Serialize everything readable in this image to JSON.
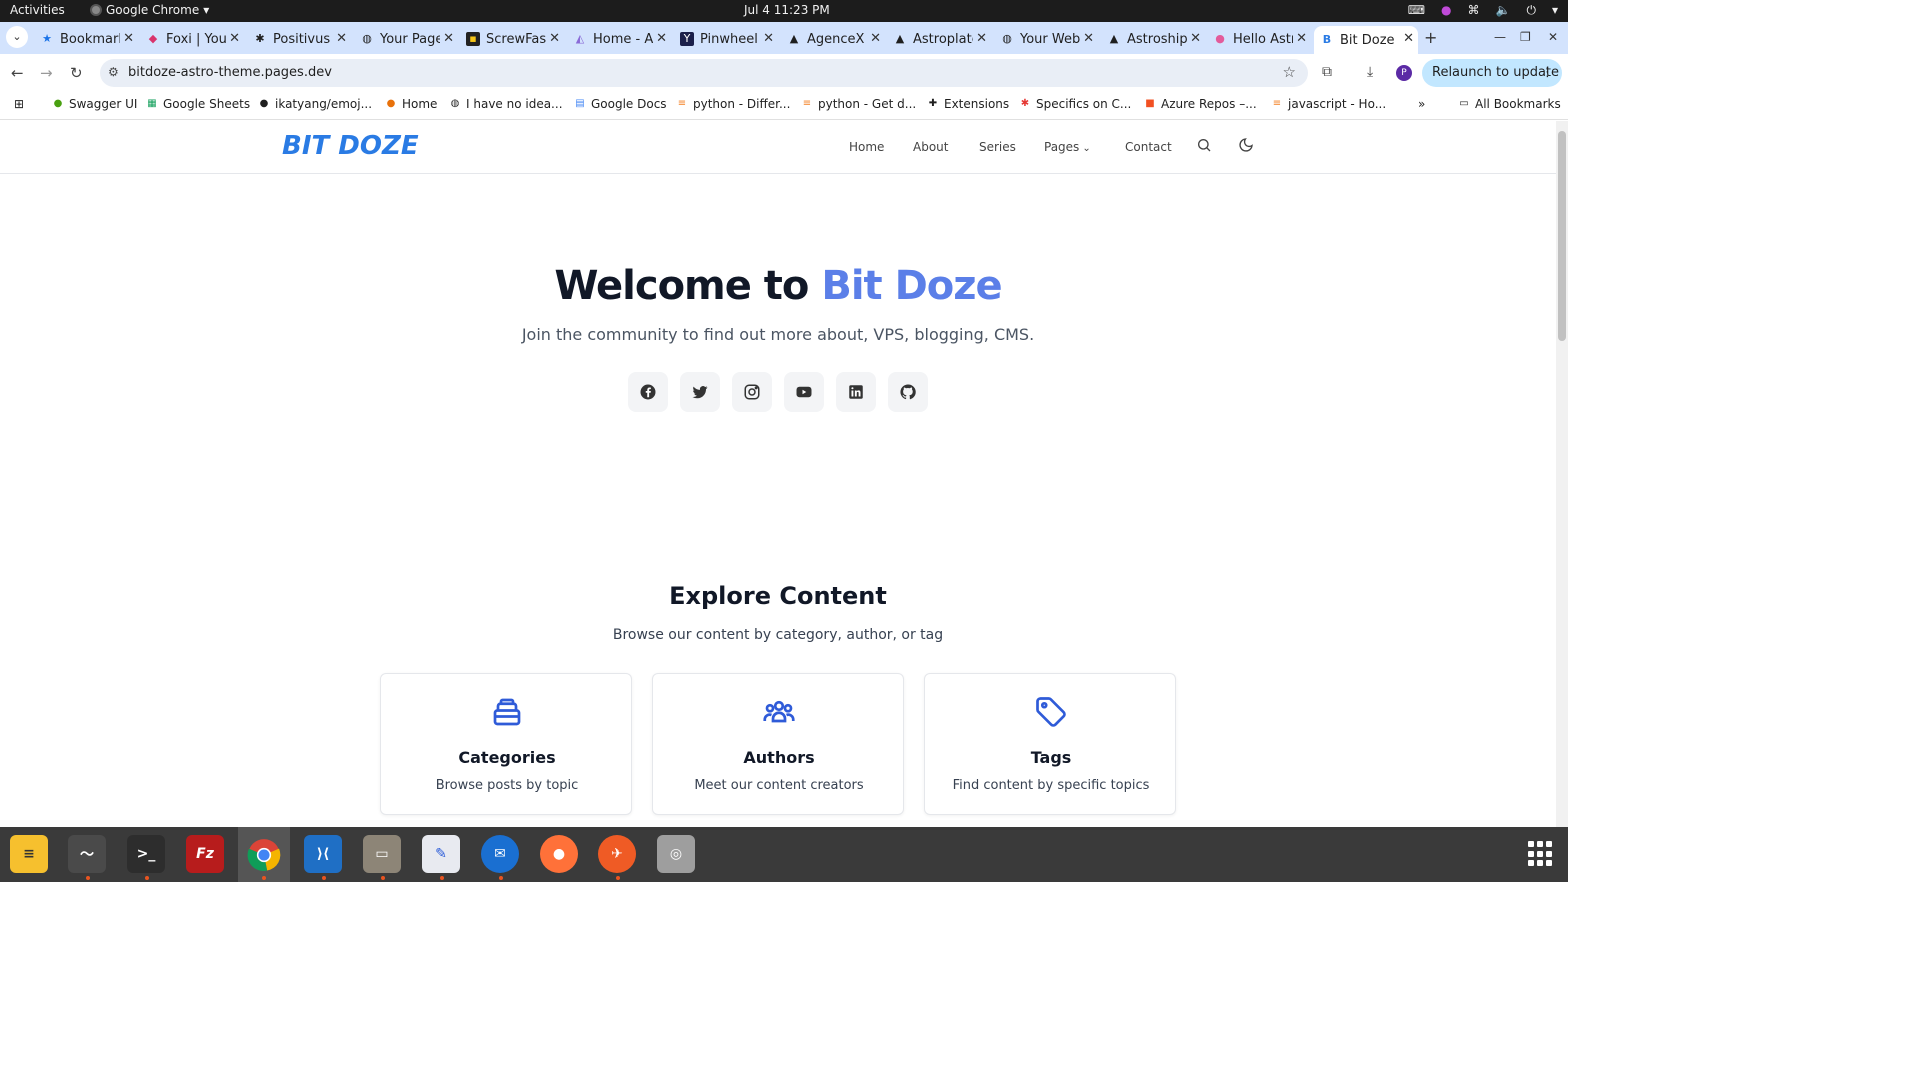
{
  "system_bar": {
    "activities": "Activities",
    "app_name": "Google Chrome",
    "clock": "Jul 4  11:23 PM"
  },
  "browser": {
    "tabs": [
      {
        "title": "Bookmarks",
        "icon": "star-icon"
      },
      {
        "title": "Foxi | Your",
        "icon": "fox-icon"
      },
      {
        "title": "Positivus",
        "icon": "positivus-icon"
      },
      {
        "title": "Your Page",
        "icon": "globe-icon"
      },
      {
        "title": "ScrewFast",
        "icon": "screwfast-icon"
      },
      {
        "title": "Home - Astro",
        "icon": "astro-icon"
      },
      {
        "title": "Pinwheel",
        "icon": "pinwheel-icon"
      },
      {
        "title": "AgenceX",
        "icon": "agencex-icon"
      },
      {
        "title": "Astroplate",
        "icon": "astroplate-icon"
      },
      {
        "title": "Your Web",
        "icon": "globe-icon"
      },
      {
        "title": "Astroship",
        "icon": "astroship-icon"
      },
      {
        "title": "Hello Astro",
        "icon": "pig-icon"
      },
      {
        "title": "Bit Doze",
        "icon": "bitdoze-icon"
      }
    ],
    "url": "bitdoze-astro-theme.pages.dev",
    "relaunch_label": "Relaunch to update",
    "profile_initial": "P",
    "bookmarks": [
      "Swagger UI",
      "Google Sheets",
      "ikatyang/emoj...",
      "Home",
      "I have no idea...",
      "Google Docs",
      "python - Differ...",
      "python - Get d...",
      "Extensions",
      "Specifics on C...",
      "Azure Repos –...",
      "javascript - Ho..."
    ],
    "all_bookmarks": "All Bookmarks",
    "overflow": "»"
  },
  "site": {
    "logo": "BIT DOZE",
    "nav": {
      "home": "Home",
      "about": "About",
      "series": "Series",
      "pages": "Pages",
      "contact": "Contact"
    },
    "hero": {
      "title_prefix": "Welcome to ",
      "title_accent": "Bit Doze",
      "subtitle": "Join the community to find out more about, VPS, blogging, CMS."
    },
    "socials": [
      "facebook-icon",
      "twitter-icon",
      "instagram-icon",
      "youtube-icon",
      "linkedin-icon",
      "github-icon"
    ],
    "explore": {
      "title": "Explore Content",
      "subtitle": "Browse our content by category, author, or tag",
      "cards": [
        {
          "title": "Categories",
          "desc": "Browse posts by topic",
          "icon": "category-icon"
        },
        {
          "title": "Authors",
          "desc": "Meet our content creators",
          "icon": "users-icon"
        },
        {
          "title": "Tags",
          "desc": "Find content by specific topics",
          "icon": "tag-icon"
        }
      ]
    }
  },
  "colors": {
    "accent": "#5b7fe8",
    "logo": "#2a7be4",
    "card_icon": "#2f5bd8",
    "tab_strip": "#d3e3fd"
  },
  "dock": {
    "apps": [
      "notes-icon",
      "system-monitor-icon",
      "terminal-icon",
      "filezilla-icon",
      "chrome-icon",
      "vscode-icon",
      "files-icon",
      "text-editor-icon",
      "thunderbird-icon",
      "firefox-icon",
      "postman-icon",
      "disk-icon"
    ]
  }
}
